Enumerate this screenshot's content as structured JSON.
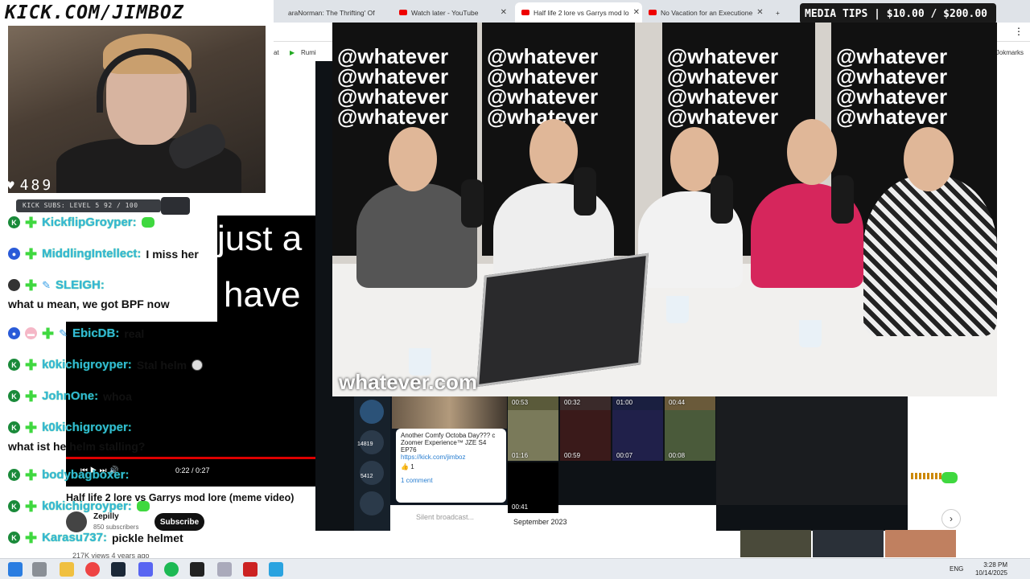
{
  "overlay": {
    "channel_url": "KICK.COM/JIMBOZ",
    "viewer_count": "489",
    "subs_goal": "KICK SUBS: LEVEL 5 92 / 100",
    "media_tips": "MEDIA TIPS | $10.00 / $200.00"
  },
  "browser": {
    "tabs": [
      {
        "label": "araNorman: The Thrifting' Of"
      },
      {
        "label": "Watch later - YouTube"
      },
      {
        "label": "Half life 2 lore vs Garrys mod lo"
      },
      {
        "label": "No Vacation for an Executione"
      }
    ],
    "bookmark_left": "at",
    "bookmark_rumble": "Rumi",
    "bookmark_right": "Jokmarks"
  },
  "chat": {
    "messages": [
      {
        "user": "KickflipGroyper:",
        "text": ""
      },
      {
        "user": "MiddlingIntellect:",
        "text": "I miss her"
      },
      {
        "user": "SLEIGH:",
        "text": "what u mean, we got BPF now"
      },
      {
        "user": "EbicDB:",
        "text": "real"
      },
      {
        "user": "k0kichigroyper:",
        "text": "Stal helm"
      },
      {
        "user": "JohnOne:",
        "text": "whoa"
      },
      {
        "user": "k0kichigroyper:",
        "text": "what ist he helm stalling?"
      },
      {
        "user": "bodybagboxer:",
        "text": ""
      },
      {
        "user": "k0kichigroyper:",
        "text": ""
      },
      {
        "user": "Karasu737:",
        "text": "pickle helmet"
      }
    ]
  },
  "lyrics": [
    "just a",
    "i have"
  ],
  "youtube": {
    "title": "Half life 2 lore vs Garrys mod lore (meme video)",
    "time": "0:22 / 0:27",
    "channel": "Zepilly",
    "subscribers": "850 subscribers",
    "subscribe": "Subscribe",
    "views": "217K views  4 years ago"
  },
  "podcast": {
    "wall_text": "@whatever",
    "watermark": "whatever.com"
  },
  "telegram": {
    "post_text": "Another Comfy Octoba Day??? c Zoomer Experience™ JZE S4 EP76",
    "post_link": "https://kick.com/jimboz",
    "reaction": "1",
    "comments": "1 comment",
    "input_placeholder": "Silent broadcast...",
    "section": "September 2023",
    "thumbs": [
      {
        "top": "00:53",
        "bottom": "01:16"
      },
      {
        "top": "00:32",
        "bottom": "00:59"
      },
      {
        "top": "01:00",
        "bottom": "00:07"
      },
      {
        "top": "00:44",
        "bottom": "00:08"
      },
      {
        "top": "",
        "bottom": "00:41"
      }
    ],
    "side_badge1": "14819",
    "side_badge2": "5412"
  },
  "taskbar": {
    "lang": "ENG",
    "time": "3:28 PM",
    "date": "10/14/2025"
  }
}
